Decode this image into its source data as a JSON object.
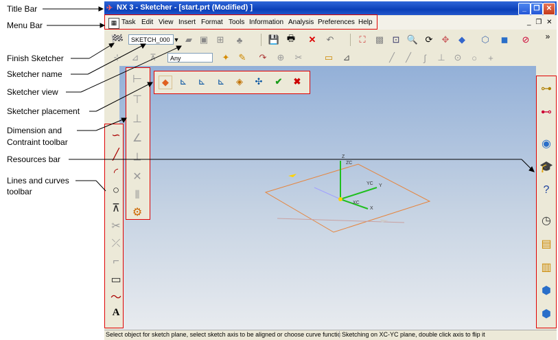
{
  "annotations": {
    "title_bar": "Title Bar",
    "menu_bar": "Menu Bar",
    "finish_sketcher": "Finish Sketcher",
    "sketcher_name": "Sketcher name",
    "sketcher_view": "Sketcher  view",
    "sketcher_placement": "Sketcher  placement",
    "dimension_toolbar_1": "Dimension and",
    "dimension_toolbar_2": "Contraint  toolbar",
    "resources_bar": "Resources bar",
    "lines_curves_1": "Lines and curves",
    "lines_curves_2": "toolbar"
  },
  "window": {
    "title": "NX 3 - Sketcher - [start.prt (Modified) ]",
    "min_glyph": "_",
    "max_glyph": "❐",
    "close_glyph": "✕"
  },
  "menu": {
    "items": [
      "Task",
      "Edit",
      "View",
      "Insert",
      "Format",
      "Tools",
      "Information",
      "Analysis",
      "Preferences",
      "Help"
    ],
    "right_controls": "_ ❐ ✕"
  },
  "toolbar": {
    "sketch_name": "SKETCH_000",
    "filter_value": "Any",
    "overflow": "»"
  },
  "status": {
    "left": "Select object for sketch plane, select sketch axis to be aligned or choose curve functic",
    "right": "Sketching on XC-YC plane, double click axis to flip it"
  },
  "viewport": {
    "axis_z": "ZC",
    "axis_y": "YC",
    "axis_x": "XC",
    "axis_z_small": "Z",
    "axis_y_small": "Y",
    "axis_x_small": "X"
  },
  "lines_toolbar": {
    "text_glyph": "A"
  },
  "colors": {
    "annotation_red": "#e00000",
    "plane_orange": "#e6843c",
    "axis_green": "#1fbf1f",
    "title_blue": "#0a3fb8"
  }
}
